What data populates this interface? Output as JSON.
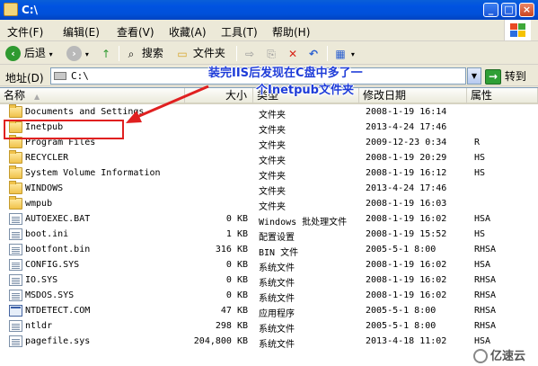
{
  "window": {
    "title": "C:\\"
  },
  "menu": [
    "文件(F)",
    "编辑(E)",
    "查看(V)",
    "收藏(A)",
    "工具(T)",
    "帮助(H)"
  ],
  "toolbar": {
    "back": "后退",
    "search": "搜索",
    "folders": "文件夹"
  },
  "address": {
    "label": "地址(D)",
    "value": "C:\\",
    "go": "转到"
  },
  "columns": {
    "name": "名称",
    "size": "大小",
    "type": "类型",
    "modified": "修改日期",
    "attributes": "属性"
  },
  "files": [
    {
      "name": "Documents and Settings",
      "size": "",
      "type": "文件夹",
      "modified": "2008-1-19 16:14",
      "attr": "",
      "icon": "folder"
    },
    {
      "name": "Inetpub",
      "size": "",
      "type": "文件夹",
      "modified": "2013-4-24 17:46",
      "attr": "",
      "icon": "folder"
    },
    {
      "name": "Program Files",
      "size": "",
      "type": "文件夹",
      "modified": "2009-12-23 0:34",
      "attr": "R",
      "icon": "folder"
    },
    {
      "name": "RECYCLER",
      "size": "",
      "type": "文件夹",
      "modified": "2008-1-19 20:29",
      "attr": "HS",
      "icon": "folder"
    },
    {
      "name": "System Volume Information",
      "size": "",
      "type": "文件夹",
      "modified": "2008-1-19 16:12",
      "attr": "HS",
      "icon": "folder"
    },
    {
      "name": "WINDOWS",
      "size": "",
      "type": "文件夹",
      "modified": "2013-4-24 17:46",
      "attr": "",
      "icon": "folder"
    },
    {
      "name": "wmpub",
      "size": "",
      "type": "文件夹",
      "modified": "2008-1-19 16:03",
      "attr": "",
      "icon": "folder"
    },
    {
      "name": "AUTOEXEC.BAT",
      "size": "0 KB",
      "type": "Windows 批处理文件",
      "modified": "2008-1-19 16:02",
      "attr": "HSA",
      "icon": "doc"
    },
    {
      "name": "boot.ini",
      "size": "1 KB",
      "type": "配置设置",
      "modified": "2008-1-19 15:52",
      "attr": "HS",
      "icon": "doc"
    },
    {
      "name": "bootfont.bin",
      "size": "316 KB",
      "type": "BIN 文件",
      "modified": "2005-5-1 8:00",
      "attr": "RHSA",
      "icon": "doc"
    },
    {
      "name": "CONFIG.SYS",
      "size": "0 KB",
      "type": "系统文件",
      "modified": "2008-1-19 16:02",
      "attr": "HSA",
      "icon": "doc"
    },
    {
      "name": "IO.SYS",
      "size": "0 KB",
      "type": "系统文件",
      "modified": "2008-1-19 16:02",
      "attr": "RHSA",
      "icon": "doc"
    },
    {
      "name": "MSDOS.SYS",
      "size": "0 KB",
      "type": "系统文件",
      "modified": "2008-1-19 16:02",
      "attr": "RHSA",
      "icon": "doc"
    },
    {
      "name": "NTDETECT.COM",
      "size": "47 KB",
      "type": "应用程序",
      "modified": "2005-5-1 8:00",
      "attr": "RHSA",
      "icon": "exe"
    },
    {
      "name": "ntldr",
      "size": "298 KB",
      "type": "系统文件",
      "modified": "2005-5-1 8:00",
      "attr": "RHSA",
      "icon": "doc"
    },
    {
      "name": "pagefile.sys",
      "size": "204,800 KB",
      "type": "系统文件",
      "modified": "2013-4-18 11:02",
      "attr": "HSA",
      "icon": "doc"
    }
  ],
  "annotation": {
    "line1": "装完IIS后发现在C盘中多了一",
    "line2": "个Inetpub文件夹",
    "color": "#1e3cd8",
    "box_color": "#e02020"
  },
  "watermark": "亿速云"
}
